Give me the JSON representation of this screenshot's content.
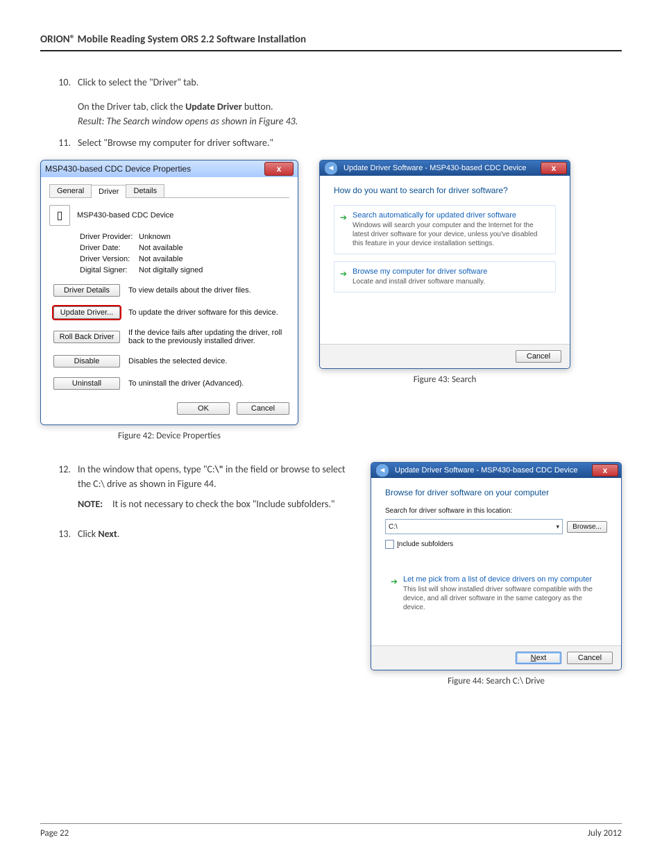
{
  "header": {
    "title": "ORION® Mobile Reading System ORS 2.2 Software Installation"
  },
  "steps": {
    "s10": {
      "num": "10.",
      "text": "Click to select the \"Driver\" tab."
    },
    "s10b_pre": "On the Driver tab, click the ",
    "s10b_bold": "Update Driver",
    "s10b_post": " button.",
    "s10c": "Result: The Search window opens as shown in Figure 43.",
    "s11": {
      "num": "11.",
      "text": "Select \"Browse my computer for driver software.\""
    },
    "s12": {
      "num": "12.",
      "text_pre": "In the window that opens, type \"C:",
      "text_bold": "\\\"",
      "text_post": " in the field or browse to select the C:\\ drive as shown in Figure 44."
    },
    "note": {
      "label": "NOTE:",
      "text": "It is not necessary to check the box \"Include subfolders.\""
    },
    "s13": {
      "num": "13.",
      "text_pre": "Click ",
      "text_bold": "Next",
      "text_post": "."
    }
  },
  "fig42": {
    "title": "MSP430-based CDC Device Properties",
    "close": "x",
    "tabs": {
      "general": "General",
      "driver": "Driver",
      "details": "Details"
    },
    "device_name": "MSP430-based CDC Device",
    "kv": {
      "provider_k": "Driver Provider:",
      "provider_v": "Unknown",
      "date_k": "Driver Date:",
      "date_v": "Not available",
      "version_k": "Driver Version:",
      "version_v": "Not available",
      "signer_k": "Digital Signer:",
      "signer_v": "Not digitally signed"
    },
    "btns": {
      "details": "Driver Details",
      "details_desc": "To view details about the driver files.",
      "update": "Update Driver...",
      "update_desc": "To update the driver software for this device.",
      "rollback": "Roll Back Driver",
      "rollback_desc": "If the device fails after updating the driver, roll back to the previously installed driver.",
      "disable": "Disable",
      "disable_desc": "Disables the selected device.",
      "uninstall": "Uninstall",
      "uninstall_desc": "To uninstall the driver (Advanced)."
    },
    "ok": "OK",
    "cancel": "Cancel",
    "caption": "Figure 42:  Device Properties"
  },
  "fig43": {
    "title": "Update Driver Software - MSP430-based CDC Device",
    "close": "x",
    "question": "How do you want to search for driver software?",
    "opt1_title": "Search automatically for updated driver software",
    "opt1_sub": "Windows will search your computer and the Internet for the latest driver software for your device, unless you've disabled this feature in your device installation settings.",
    "opt2_title": "Browse my computer for driver software",
    "opt2_sub": "Locate and install driver software manually.",
    "cancel": "Cancel",
    "caption": "Figure 43:  Search"
  },
  "fig44": {
    "title": "Update Driver Software - MSP430-based CDC Device",
    "close": "x",
    "heading": "Browse for driver software on your computer",
    "label": "Search for driver software in this location:",
    "path": "C:\\",
    "browse": "Browse...",
    "include_u": "I",
    "include_rest": "nclude subfolders",
    "pick_title": "Let me pick from a list of device drivers on my computer",
    "pick_sub": "This list will show installed driver software compatible with the device, and all driver software in the same category as the device.",
    "next_u": "N",
    "next_rest": "ext",
    "cancel": "Cancel",
    "caption": "Figure 44:  Search C:\\ Drive"
  },
  "footer": {
    "left": "Page 22",
    "right": "July 2012"
  }
}
